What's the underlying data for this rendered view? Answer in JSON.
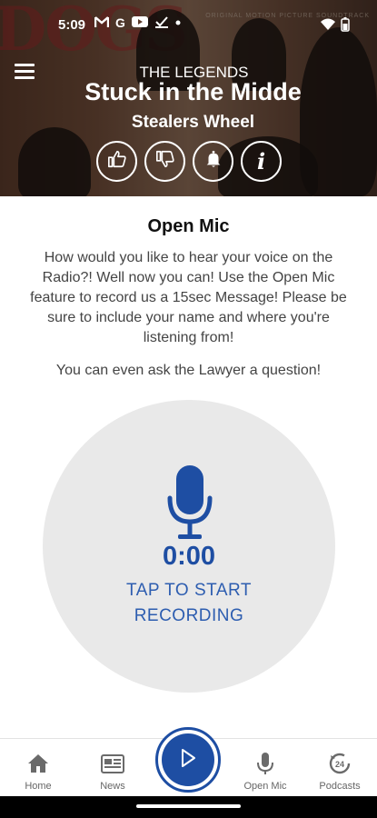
{
  "status_bar": {
    "time": "5:09",
    "icons": [
      "gmail-icon",
      "google-icon",
      "youtube-icon",
      "task-icon",
      "dot-icon",
      "wifi-icon",
      "battery-icon"
    ]
  },
  "now_playing": {
    "station": "THE LEGENDS",
    "song": "Stuck in the Midde",
    "artist": "Stealers Wheel",
    "background_art_text": "DOGS",
    "background_small_text": "ORIGINAL MOTION PICTURE SOUNDTRACK",
    "actions": [
      "thumbs-up-icon",
      "thumbs-down-icon",
      "bell-icon",
      "info-icon"
    ]
  },
  "open_mic": {
    "title": "Open Mic",
    "description": "How would you like to hear your voice on the Radio?! Well now you can! Use the Open Mic feature to record us a 15sec Message! Please be sure to include your name and where you're listening from!",
    "description_2": "You can even ask the Lawyer a question!",
    "timer": "0:00",
    "record_label": "TAP TO START RECORDING"
  },
  "bottom_nav": {
    "items": [
      {
        "label": "Home",
        "icon": "home-icon"
      },
      {
        "label": "News",
        "icon": "news-icon"
      },
      {
        "label": "Open Mic",
        "icon": "microphone-icon"
      },
      {
        "label": "Podcasts",
        "icon": "podcast-24-icon"
      }
    ]
  },
  "colors": {
    "accent": "#1e4ea3",
    "record_circle": "#e9e9e9",
    "nav_text": "#666666"
  }
}
